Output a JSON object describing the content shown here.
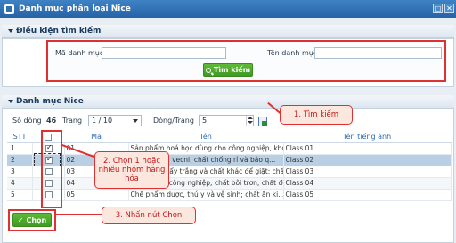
{
  "window": {
    "title": "Danh mục phân loại Nice"
  },
  "search_panel": {
    "header": "Điều kiện tìm kiếm",
    "ma_label": "Mã danh mục:",
    "ma_value": "",
    "ten_label": "Tên danh mục:",
    "ten_value": "",
    "search_button": "Tìm kiếm"
  },
  "list_panel": {
    "header": "Danh mục Nice",
    "so_dong_label": "Số dòng",
    "so_dong_value": "46",
    "trang_label": "Trang",
    "trang_value": "1 / 10",
    "dong_trang_label": "Dòng/Trang",
    "dong_trang_value": "5"
  },
  "table": {
    "columns": [
      "STT",
      "",
      "Mã",
      "Tên",
      "Tên tiếng anh"
    ],
    "rows": [
      {
        "stt": "1",
        "checked": true,
        "ma": "01",
        "ten": "Sản phẩm hoá học dùng cho công nghiệp, khoa...",
        "ten_en": "Class 01"
      },
      {
        "stt": "2",
        "checked": true,
        "ma": "02",
        "ten": "Thuốc màu, vecni, chất chống rỉ và bảo q...",
        "ten_en": "Class 02"
      },
      {
        "stt": "3",
        "checked": false,
        "ma": "03",
        "ten": "Chế phẩm tẩy trắng và chất khác để giặt; chất để...",
        "ten_en": "Class 03"
      },
      {
        "stt": "4",
        "checked": false,
        "ma": "04",
        "ten": "Dầu và mỡ công nghiệp; chất bôi trơn, chất để h...",
        "ten_en": "Class 04"
      },
      {
        "stt": "5",
        "checked": false,
        "ma": "05",
        "ten": "Chế phẩm dược, thú y và vệ sinh; chất ăn ki...",
        "ten_en": "Class 05"
      }
    ]
  },
  "select_button": "Chọn",
  "callouts": {
    "step1": "1. Tìm kiếm",
    "step2": "2. Chọn 1 hoặc nhiều nhóm hàng hóa",
    "step3": "3. Nhấn nút Chọn"
  },
  "colors": {
    "accent_green": "#4caf2f",
    "highlight_red": "#e03030",
    "titlebar_blue": "#2f6fb3"
  }
}
